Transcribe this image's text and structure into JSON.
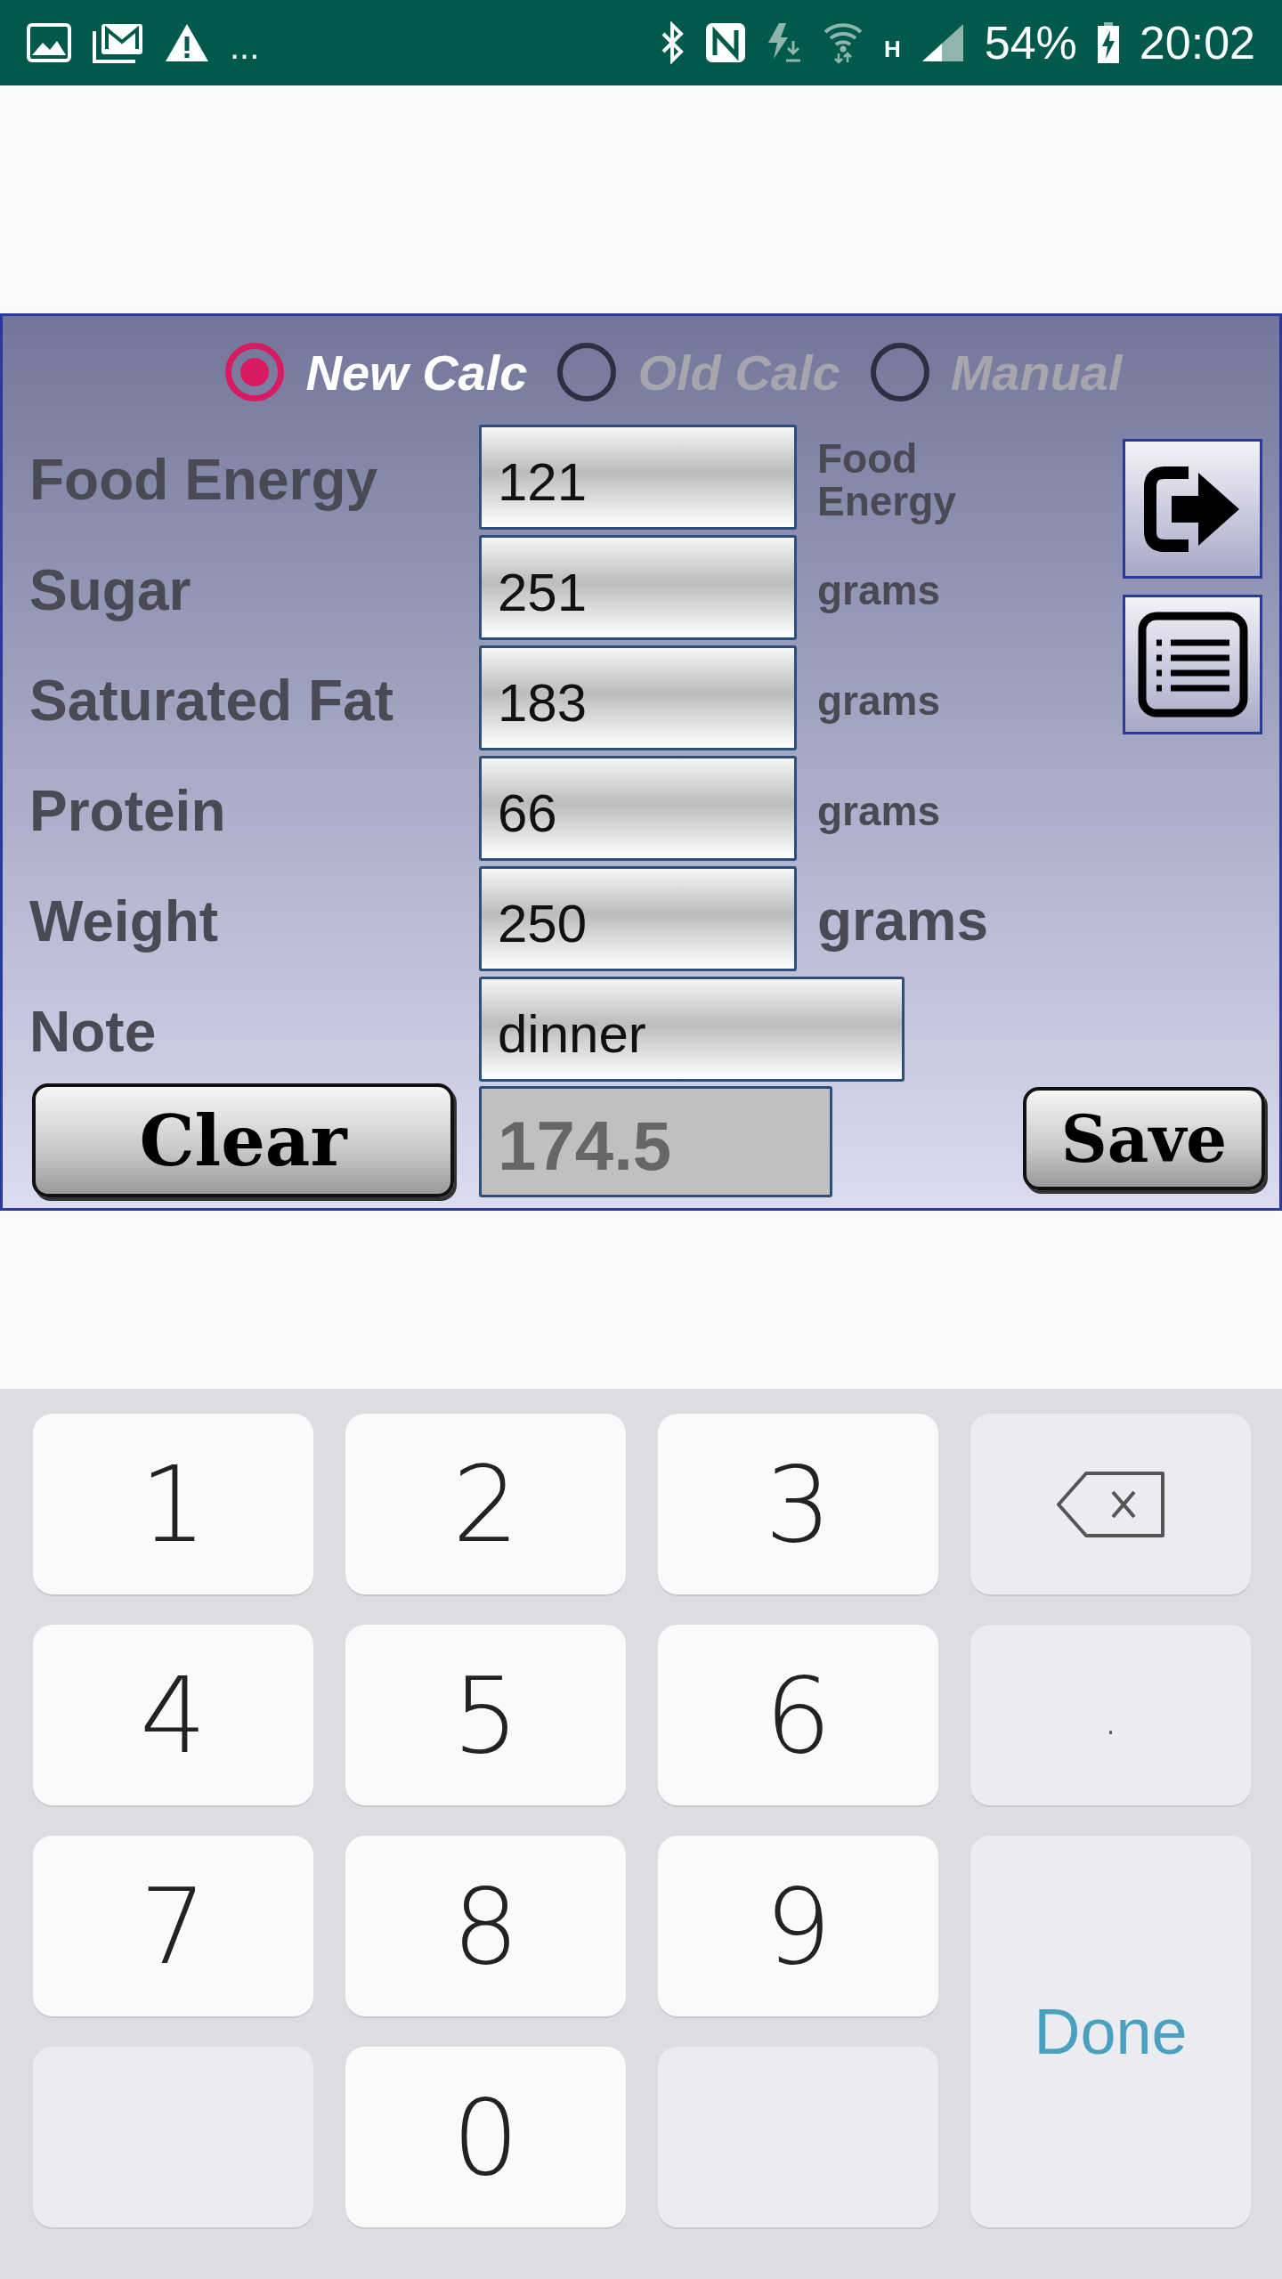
{
  "status_bar": {
    "overflow": "...",
    "network": "H",
    "battery": "54%",
    "time": "20:02"
  },
  "calc_modes": [
    {
      "label": "New Calc",
      "selected": true
    },
    {
      "label": "Old Calc",
      "selected": false
    },
    {
      "label": "Manual",
      "selected": false
    }
  ],
  "rows": [
    {
      "label": "Food Energy",
      "value": "121",
      "unit": "Food Energy",
      "kind": "small"
    },
    {
      "label": "Sugar",
      "value": "251",
      "unit": "grams",
      "kind": "small"
    },
    {
      "label": "Saturated Fat",
      "value": "183",
      "unit": "grams",
      "kind": "small"
    },
    {
      "label": "Protein",
      "value": "66",
      "unit": "grams",
      "kind": "small"
    },
    {
      "label": "Weight",
      "value": "250",
      "unit": "grams",
      "kind": "large"
    }
  ],
  "note": {
    "label": "Note",
    "value": "dinner"
  },
  "result": "174.5",
  "buttons": {
    "clear": "Clear",
    "save": "Save"
  },
  "keypad": [
    {
      "kind": "digit",
      "label": "1"
    },
    {
      "kind": "digit",
      "label": "2"
    },
    {
      "kind": "digit",
      "label": "3"
    },
    {
      "kind": "backspace"
    },
    {
      "kind": "digit",
      "label": "4"
    },
    {
      "kind": "digit",
      "label": "5"
    },
    {
      "kind": "digit",
      "label": "6"
    },
    {
      "kind": "dot",
      "label": "."
    },
    {
      "kind": "digit",
      "label": "7"
    },
    {
      "kind": "digit",
      "label": "8"
    },
    {
      "kind": "digit",
      "label": "9"
    },
    {
      "kind": "done",
      "label": "Done"
    },
    {
      "kind": "blank"
    },
    {
      "kind": "digit",
      "label": "0"
    },
    {
      "kind": "blank"
    }
  ]
}
